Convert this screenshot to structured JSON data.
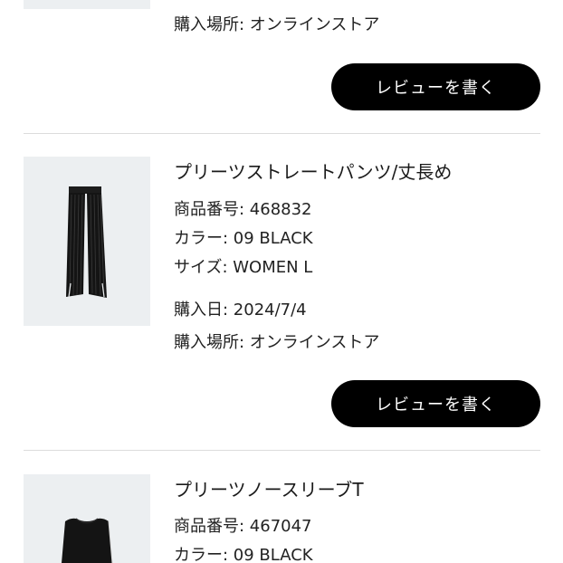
{
  "items": [
    {
      "place_label": "購入場所: オンラインストア",
      "review_label": "レビューを書く"
    },
    {
      "name": "プリーツストレートパンツ/丈長め",
      "product_number": "商品番号: 468832",
      "color": "カラー: 09 BLACK",
      "size": "サイズ: WOMEN L",
      "purchase_date": "購入日: 2024/7/4",
      "place_label": "購入場所: オンラインストア",
      "review_label": "レビューを書く",
      "image_icon": "black-pleated-pants"
    },
    {
      "name": "プリーツノースリーブT",
      "product_number": "商品番号: 467047",
      "color": "カラー: 09 BLACK",
      "image_icon": "black-sleeveless-top"
    }
  ],
  "colors": {
    "button_bg": "#000000",
    "button_text": "#ffffff",
    "thumb_bg": "#eceff1",
    "divider": "#dcdcdc"
  }
}
